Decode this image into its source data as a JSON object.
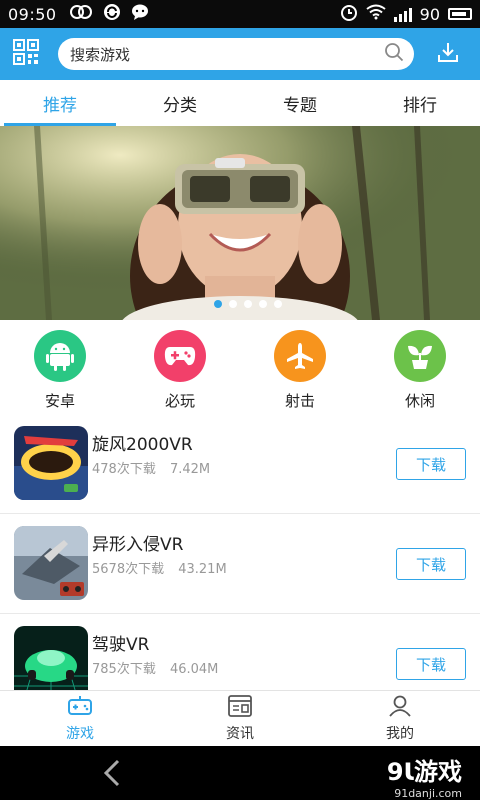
{
  "status_bar": {
    "time": "09:50",
    "battery": "90"
  },
  "search": {
    "placeholder": "搜索游戏"
  },
  "tabs": [
    {
      "label": "推荐"
    },
    {
      "label": "分类"
    },
    {
      "label": "专题"
    },
    {
      "label": "排行"
    }
  ],
  "categories": [
    {
      "label": "安卓",
      "color": "#2ac784",
      "icon": "android-icon"
    },
    {
      "label": "必玩",
      "color": "#f2406a",
      "icon": "gamepad-icon"
    },
    {
      "label": "射击",
      "color": "#f7941d",
      "icon": "airplane-icon"
    },
    {
      "label": "休闲",
      "color": "#6cc24a",
      "icon": "sprout-icon"
    }
  ],
  "games": [
    {
      "name": "旋风2000VR",
      "downloads": "478次下载",
      "size": "7.42M",
      "button": "下载"
    },
    {
      "name": "异形入侵VR",
      "downloads": "5678次下载",
      "size": "43.21M",
      "button": "下载"
    },
    {
      "name": "驾驶VR",
      "downloads": "785次下载",
      "size": "46.04M",
      "button": "下载"
    }
  ],
  "bottom_nav": [
    {
      "label": "游戏"
    },
    {
      "label": "资讯"
    },
    {
      "label": "我的"
    }
  ],
  "watermark": {
    "brand": "9Ɩ游戏",
    "url": "91danji.com"
  },
  "colors": {
    "accent": "#2fa4e7"
  }
}
